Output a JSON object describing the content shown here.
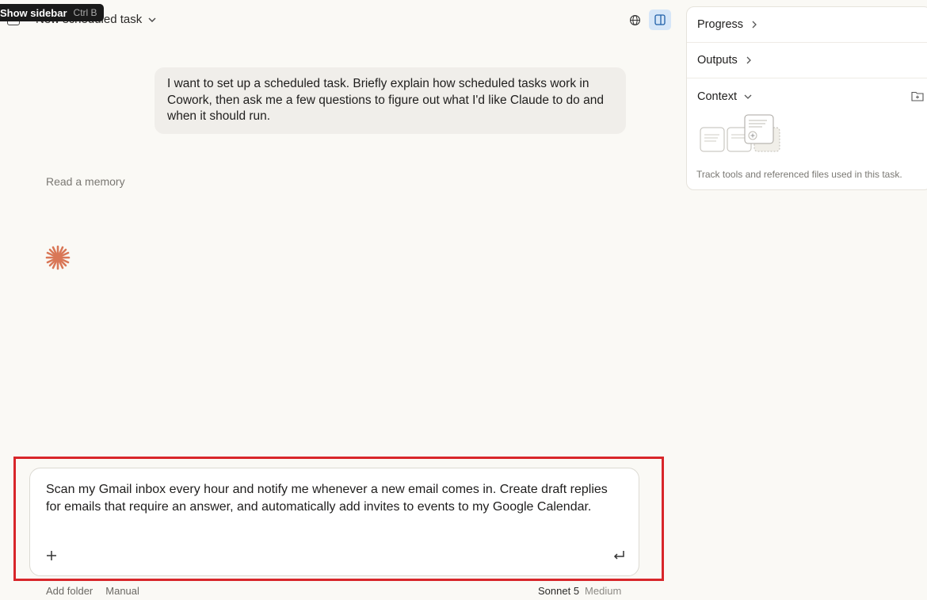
{
  "header": {
    "task_title": "New scheduled task",
    "tooltip_label": "Show sidebar",
    "tooltip_shortcut": "Ctrl B"
  },
  "conversation": {
    "user_message": "I want to set up a scheduled task. Briefly explain how scheduled tasks work in Cowork, then ask me a few questions to figure out what I'd like Claude to do and when it should run.",
    "memory_link": "Read a memory"
  },
  "composer": {
    "text": "Scan my Gmail inbox every hour and notify me whenever a new email comes in. Create draft replies for emails that require an answer, and automatically add invites to events to my Google Calendar.",
    "add_folder_label": "Add folder",
    "mode_label": "Manual",
    "model_name": "Sonnet 5",
    "model_effort": "Medium"
  },
  "side_panel": {
    "progress_label": "Progress",
    "outputs_label": "Outputs",
    "context_label": "Context",
    "context_hint": "Track tools and referenced files used in this task."
  },
  "colors": {
    "background": "#faf9f5",
    "accent": "#d97757",
    "highlight": "#d8262a",
    "active_button": "#d6e6f8"
  },
  "icons": {
    "sidebar_toggle": "sidebar-icon",
    "globe": "globe-icon",
    "panel": "panel-right-icon",
    "add": "plus-icon",
    "submit": "enter-icon",
    "claude": "claude-spark-icon"
  }
}
